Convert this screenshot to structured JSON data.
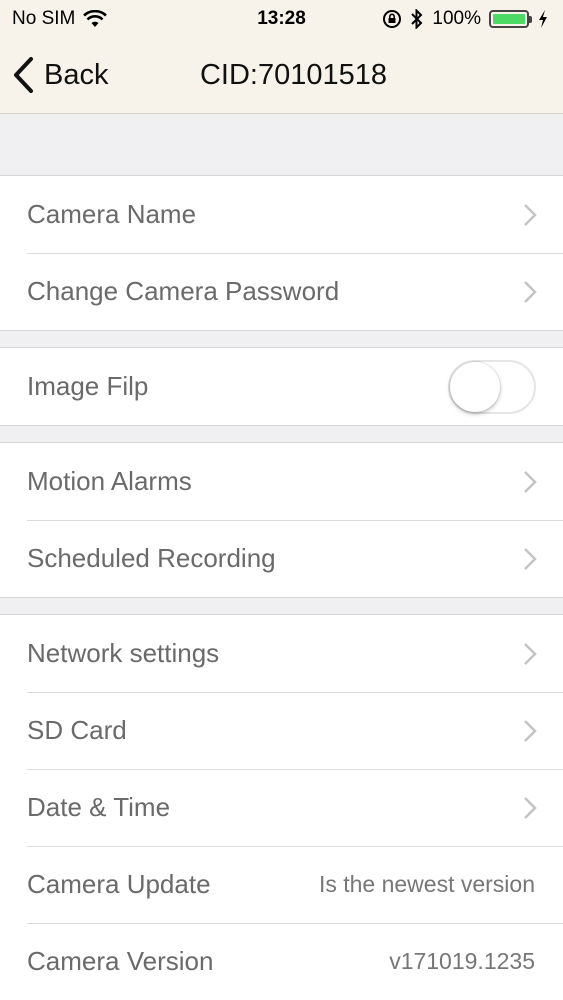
{
  "status_bar": {
    "carrier": "No SIM",
    "time": "13:28",
    "battery_percent": "100%",
    "battery_level": 1.0,
    "icons": [
      "wifi-icon",
      "rotation-lock-icon",
      "bluetooth-icon",
      "battery-icon",
      "charging-icon"
    ]
  },
  "nav": {
    "back_label": "Back",
    "title": "CID:70101518"
  },
  "sections": [
    {
      "rows": [
        {
          "label": "Camera Name"
        },
        {
          "label": "Change Camera Password"
        }
      ]
    },
    {
      "rows": [
        {
          "label": "Image Filp",
          "toggle_on": false
        }
      ]
    },
    {
      "rows": [
        {
          "label": "Motion Alarms"
        },
        {
          "label": "Scheduled Recording"
        }
      ]
    },
    {
      "rows": [
        {
          "label": "Network settings"
        },
        {
          "label": "SD Card"
        },
        {
          "label": "Date & Time"
        },
        {
          "label": "Camera Update",
          "value": "Is the newest version"
        },
        {
          "label": "Camera Version",
          "value": "v171019.1235"
        }
      ]
    }
  ],
  "colors": {
    "nav_background": "#f8f3ea",
    "page_background": "#f0f0f2",
    "label_text": "#6a6a6a",
    "battery_fill": "#4cd964"
  }
}
